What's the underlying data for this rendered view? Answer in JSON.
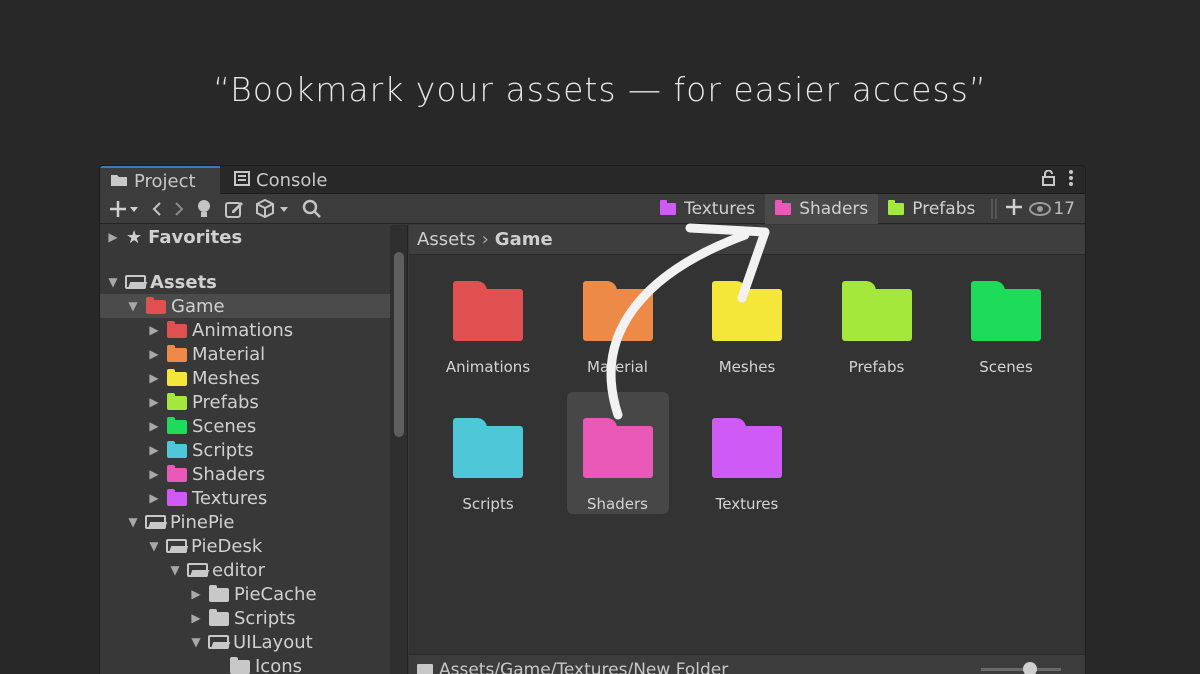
{
  "headline": "“Bookmark your assets — for easier access”",
  "tabs": [
    {
      "label": "Project",
      "icon": "folder-icon"
    },
    {
      "label": "Console",
      "icon": "console-icon"
    }
  ],
  "toolbar": {
    "bookmarks": [
      {
        "label": "Textures",
        "color": "#cf5af5"
      },
      {
        "label": "Shaders",
        "color": "#ea59b8"
      },
      {
        "label": "Prefabs",
        "color": "#a3e83a"
      }
    ],
    "visible_count": "17"
  },
  "tree": {
    "favorites": "Favorites",
    "assets": "Assets",
    "game": "Game",
    "game_children": [
      {
        "label": "Animations",
        "color": "#e05050"
      },
      {
        "label": "Material",
        "color": "#ee8a48"
      },
      {
        "label": "Meshes",
        "color": "#f5e63a"
      },
      {
        "label": "Prefabs",
        "color": "#a3e83a"
      },
      {
        "label": "Scenes",
        "color": "#1edc5a"
      },
      {
        "label": "Scripts",
        "color": "#4ec8d8"
      },
      {
        "label": "Shaders",
        "color": "#ea59b8"
      },
      {
        "label": "Textures",
        "color": "#cf5af5"
      }
    ],
    "pinepie": "PinePie",
    "piedesk": "PieDesk",
    "editor": "editor",
    "piecache": "PieCache",
    "scripts": "Scripts",
    "uilayout": "UILayout",
    "icons": "Icons"
  },
  "breadcrumb": {
    "root": "Assets",
    "current": "Game"
  },
  "grid": [
    {
      "label": "Animations",
      "color": "#e05050"
    },
    {
      "label": "Material",
      "color": "#ee8a48"
    },
    {
      "label": "Meshes",
      "color": "#f5e63a"
    },
    {
      "label": "Prefabs",
      "color": "#a3e83a"
    },
    {
      "label": "Scenes",
      "color": "#1edc5a"
    },
    {
      "label": "Scripts",
      "color": "#4ec8d8"
    },
    {
      "label": "Shaders",
      "color": "#ea59b8"
    },
    {
      "label": "Textures",
      "color": "#cf5af5"
    }
  ],
  "status_path": "Assets/Game/Textures/New Folder",
  "selected_grid_item": "Shaders"
}
